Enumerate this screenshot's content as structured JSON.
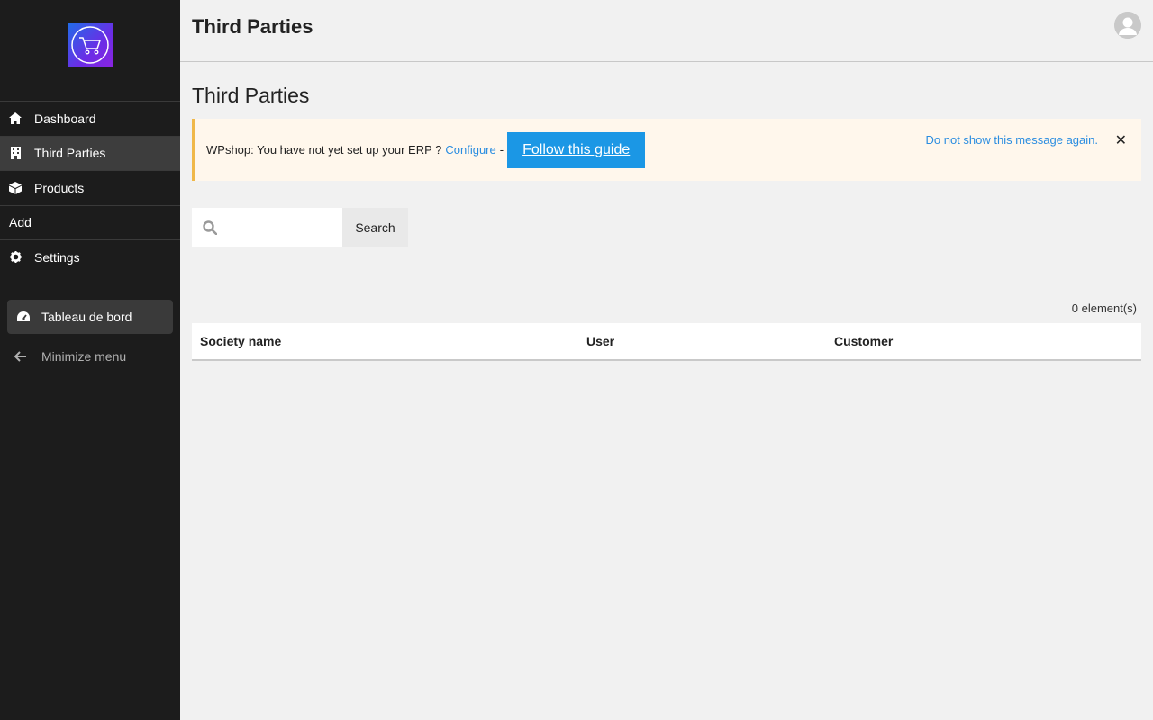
{
  "header": {
    "title": "Third Parties"
  },
  "sidebar": {
    "items": [
      {
        "label": "Dashboard",
        "icon": "home-icon"
      },
      {
        "label": "Third Parties",
        "icon": "building-icon"
      },
      {
        "label": "Products",
        "icon": "box-icon"
      },
      {
        "label": "Add"
      },
      {
        "label": "Settings",
        "icon": "gear-icon"
      }
    ],
    "dashboard_button": "Tableau de bord",
    "minimize": "Minimize menu"
  },
  "main": {
    "title": "Third Parties",
    "notice": {
      "text": "WPshop: You have not yet set up your ERP ?",
      "configure_link": "Configure",
      "separator": "-",
      "guide_button": "Follow this guide",
      "dismiss_link": "Do not show this message again.",
      "close": "✕"
    },
    "search": {
      "placeholder": "",
      "button": "Search"
    },
    "count": "0 element(s)",
    "table": {
      "columns": [
        "Society name",
        "User",
        "Customer"
      ]
    }
  },
  "colors": {
    "sidebar": "#1c1c1c",
    "accent": "#1b97e5",
    "link": "#2a8de0",
    "notice_border": "#f0b849"
  }
}
